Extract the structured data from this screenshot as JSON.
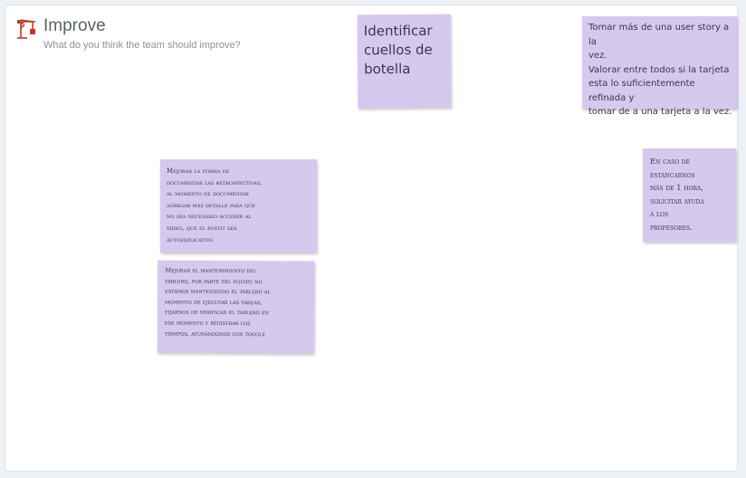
{
  "section": {
    "title": "Improve",
    "subtitle": "What do you think the team should improve?",
    "icon": "crane-icon"
  },
  "colors": {
    "sticky_background": "#d5c9ee",
    "sticky_text": "#3c3650",
    "icon": "#c0392b"
  },
  "stickies": [
    {
      "text": "Identificar\ncuellos de\nbotella"
    },
    {
      "text": "Tomar más de una user story a la\nvez.\nValorar entre todos si la tarjeta\nesta lo suficientemente refinada y\ntomar de a una tarjeta a la vez."
    },
    {
      "text": "Mejorar la forma de\ndocumentar las retrospectivas,\nal momento de documentar\nagregar más detalle para que\nno sea necesario acceder al\nvideo, que el postit sea\nautoexplicativo"
    },
    {
      "text": "Mejorar el mantenimiento del\ntablero, por parte del equipo no\nestamos manteniendo el tablero al\nmomento de ejecutar las tareas,\nfijarnos de verificar el tablero en\nese momento y registrar los\ntiempos, ayudándonos con toggle"
    },
    {
      "text": "En caso de\nestancarnos\nmás de 1 hora,\nsolicitar ayuda\na los\nprofesores."
    }
  ]
}
